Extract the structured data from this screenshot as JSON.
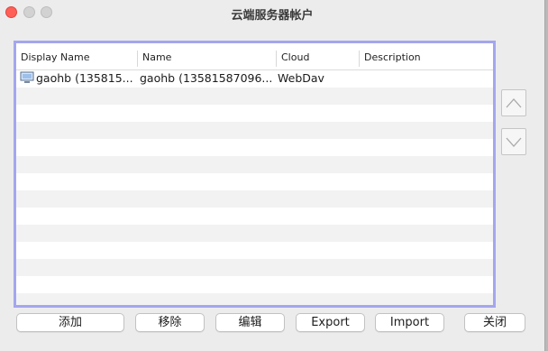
{
  "window": {
    "title": "云端服务器帐户"
  },
  "table": {
    "columns": [
      "Display Name",
      "Name",
      "Cloud",
      "Description"
    ],
    "rows": [
      {
        "display_name": "gaohb (135815...",
        "name": "gaohb (13581587096...",
        "cloud": "WebDav",
        "description": ""
      }
    ]
  },
  "side_buttons": {
    "up_icon": "chevron-up-icon",
    "down_icon": "chevron-down-icon"
  },
  "buttons": {
    "add": "添加",
    "remove": "移除",
    "edit": "编辑",
    "export": "Export",
    "import": "Import",
    "close": "关闭"
  },
  "colors": {
    "selection_border": "#a4a6ef",
    "close_dot": "#fe5f57"
  }
}
